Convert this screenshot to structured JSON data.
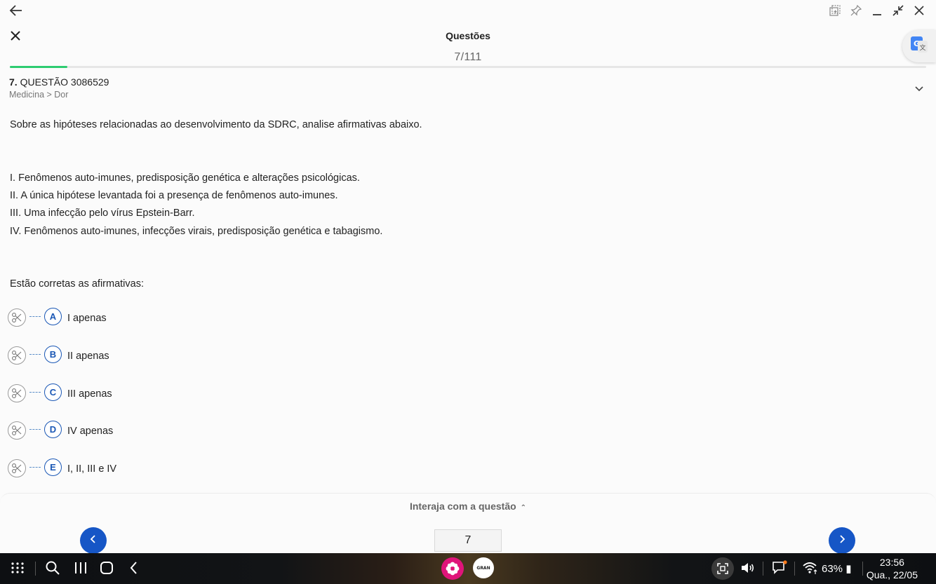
{
  "header": {
    "title": "Questões",
    "counter": "7/111",
    "progress_fraction": 0.063
  },
  "question": {
    "number": "7.",
    "label": "QUESTÃO 3086529",
    "category": "Medicina > Dor",
    "prompt": "Sobre as hipóteses relacionadas ao desenvolvimento da SDRC, analise afirmativas abaixo.",
    "statements": [
      "I. Fenômenos auto-imunes, predisposição genética e alterações psicológicas.",
      "II. A única hipótese levantada foi a presença de fenômenos auto-imunes.",
      "III. Uma infecção pelo vírus Epstein-Barr.",
      "IV. Fenômenos auto-imunes, infecções virais, predisposição genética e tabagismo."
    ],
    "ask": "Estão corretas as afirmativas:",
    "options": [
      {
        "letter": "A",
        "text": "I apenas"
      },
      {
        "letter": "B",
        "text": "II apenas"
      },
      {
        "letter": "C",
        "text": "III apenas"
      },
      {
        "letter": "D",
        "text": "IV apenas"
      },
      {
        "letter": "E",
        "text": "I, II, III e IV"
      }
    ]
  },
  "footer": {
    "interact_label": "Interaja com a questão",
    "page_value": "7"
  },
  "taskbar": {
    "gran_label": "GRAN",
    "battery": "63%",
    "time": "23:56",
    "date": "Qua., 22/05"
  },
  "colors": {
    "accent_blue": "#1656c6",
    "progress_green": "#2ecc71",
    "app_pink": "#e0147a"
  }
}
